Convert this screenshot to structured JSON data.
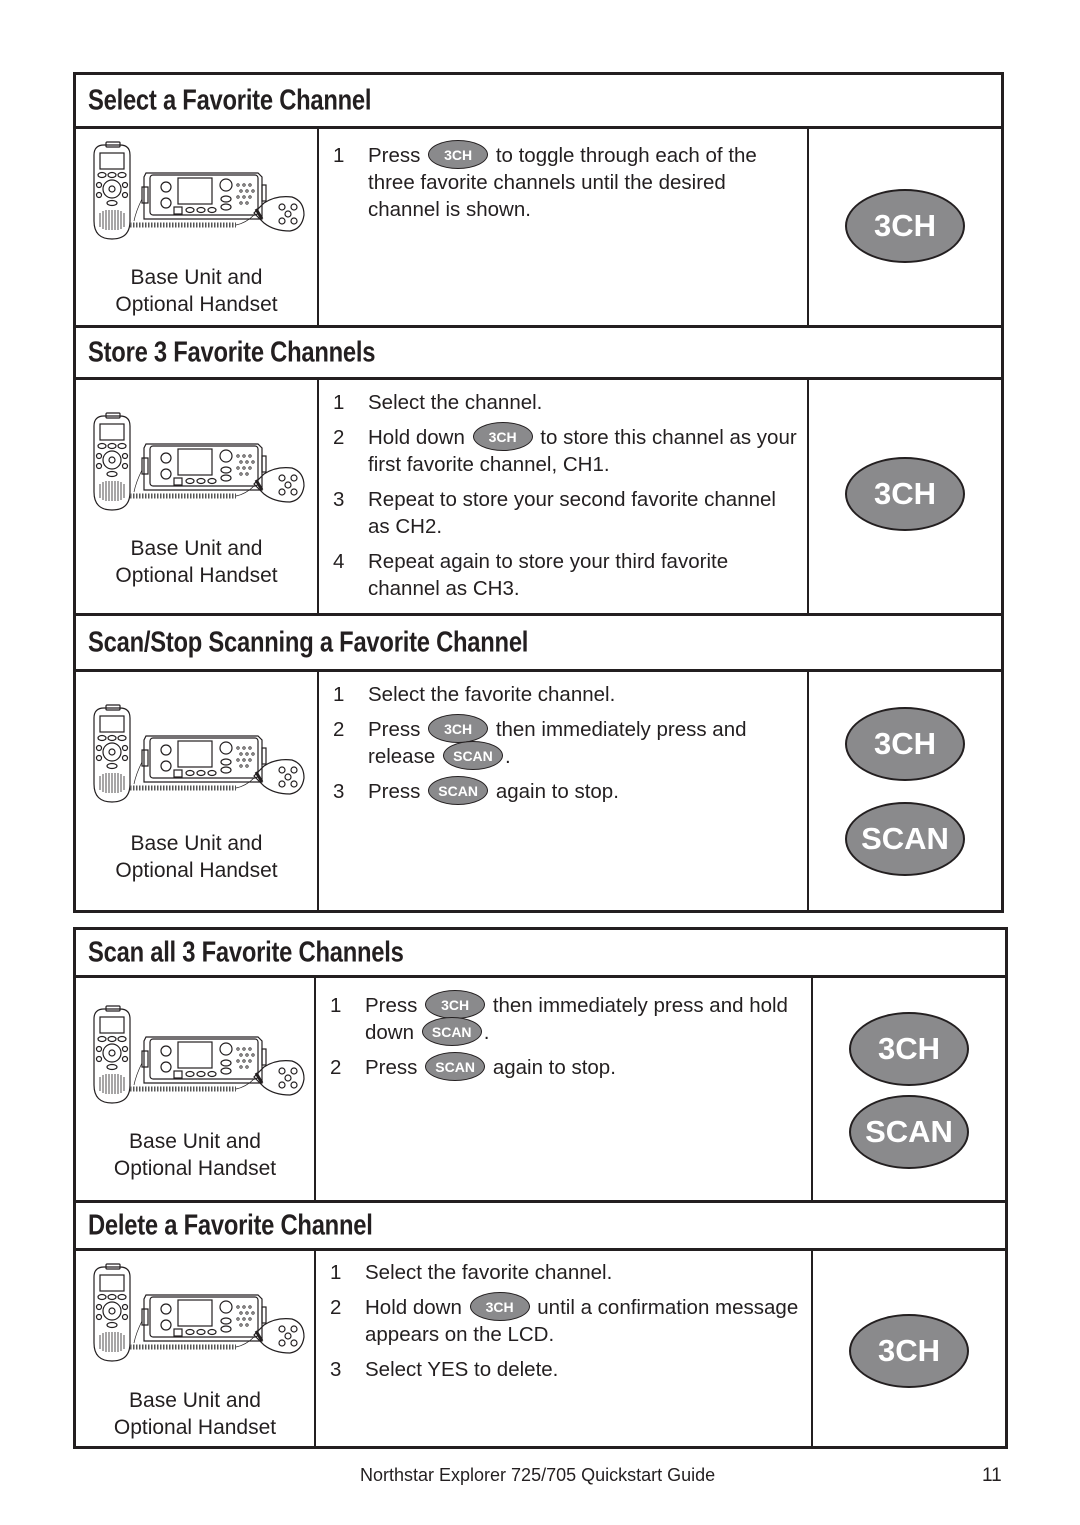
{
  "sections": [
    {
      "title": "Select a Favorite Channel",
      "caption_line1": "Base Unit and",
      "caption_line2": "Optional Handset",
      "steps": [
        {
          "num": "1",
          "parts": [
            {
              "t": "Press"
            },
            {
              "btn": "3CH"
            },
            {
              "t": "to toggle through each of the three favorite channels until the desired channel is shown."
            }
          ]
        }
      ],
      "buttons": [
        "3CH"
      ]
    },
    {
      "title": "Store 3 Favorite Channels",
      "caption_line1": "Base Unit and",
      "caption_line2": "Optional Handset",
      "steps": [
        {
          "num": "1",
          "parts": [
            {
              "t": "Select the channel."
            }
          ]
        },
        {
          "num": "2",
          "parts": [
            {
              "t": "Hold down"
            },
            {
              "btn": "3CH"
            },
            {
              "t": "to store this channel as your first favorite channel, CH1."
            }
          ]
        },
        {
          "num": "3",
          "parts": [
            {
              "t": "Repeat to store your second favorite channel as CH2."
            }
          ]
        },
        {
          "num": "4",
          "parts": [
            {
              "t": "Repeat again to store your third favorite channel as CH3."
            }
          ]
        }
      ],
      "buttons": [
        "3CH"
      ]
    },
    {
      "title": "Scan/Stop Scanning a Favorite Channel",
      "caption_line1": "Base Unit and",
      "caption_line2": "Optional Handset",
      "steps": [
        {
          "num": "1",
          "parts": [
            {
              "t": "Select the favorite channel."
            }
          ]
        },
        {
          "num": "2",
          "parts": [
            {
              "t": "Press"
            },
            {
              "btn": "3CH"
            },
            {
              "t": "then immediately press and release"
            },
            {
              "btn": "SCAN"
            },
            {
              "t": "."
            }
          ]
        },
        {
          "num": "3",
          "parts": [
            {
              "t": "Press"
            },
            {
              "btn": "SCAN"
            },
            {
              "t": "again to stop."
            }
          ]
        }
      ],
      "buttons": [
        "3CH",
        "SCAN"
      ]
    },
    {
      "title": "Scan all 3 Favorite Channels",
      "caption_line1": "Base Unit and",
      "caption_line2": "Optional Handset",
      "steps": [
        {
          "num": "1",
          "parts": [
            {
              "t": "Press"
            },
            {
              "btn": "3CH"
            },
            {
              "t": "then immediately press and hold down"
            },
            {
              "btn": "SCAN"
            },
            {
              "t": "."
            }
          ]
        },
        {
          "num": "2",
          "parts": [
            {
              "t": "Press"
            },
            {
              "btn": "SCAN"
            },
            {
              "t": "again to stop."
            }
          ]
        }
      ],
      "buttons": [
        "3CH",
        "SCAN"
      ]
    },
    {
      "title": "Delete a Favorite Channel",
      "caption_line1": "Base Unit and",
      "caption_line2": "Optional Handset",
      "steps": [
        {
          "num": "1",
          "parts": [
            {
              "t": "Select the favorite channel."
            }
          ]
        },
        {
          "num": "2",
          "parts": [
            {
              "t": "Hold down"
            },
            {
              "btn": "3CH"
            },
            {
              "t": "until a confirmation message appears on the LCD."
            }
          ]
        },
        {
          "num": "3",
          "parts": [
            {
              "t": "Select YES to delete."
            }
          ]
        }
      ],
      "buttons": [
        "3CH"
      ]
    }
  ],
  "colors": {
    "button_fill": "#8a8a8c",
    "ink": "#231f20"
  },
  "footer": {
    "title": "Northstar Explorer 725/705 Quickstart Guide",
    "page": "11"
  }
}
